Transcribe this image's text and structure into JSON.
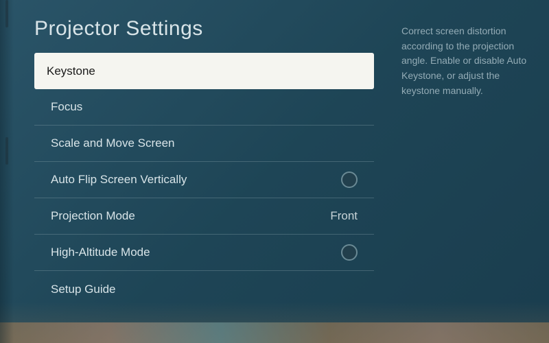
{
  "title": "Projector Settings",
  "menu": {
    "items": [
      {
        "label": "Keystone",
        "selected": true,
        "type": "nav"
      },
      {
        "label": "Focus",
        "type": "nav"
      },
      {
        "label": "Scale and Move Screen",
        "type": "nav"
      },
      {
        "label": "Auto Flip Screen Vertically",
        "type": "radio",
        "value": "off"
      },
      {
        "label": "Projection Mode",
        "type": "value",
        "value": "Front"
      },
      {
        "label": "High-Altitude Mode",
        "type": "radio",
        "value": "off"
      },
      {
        "label": "Setup Guide",
        "type": "nav"
      }
    ]
  },
  "description": "Correct screen distortion according to the projection angle. Enable or disable Auto Keystone, or adjust the keystone manually."
}
